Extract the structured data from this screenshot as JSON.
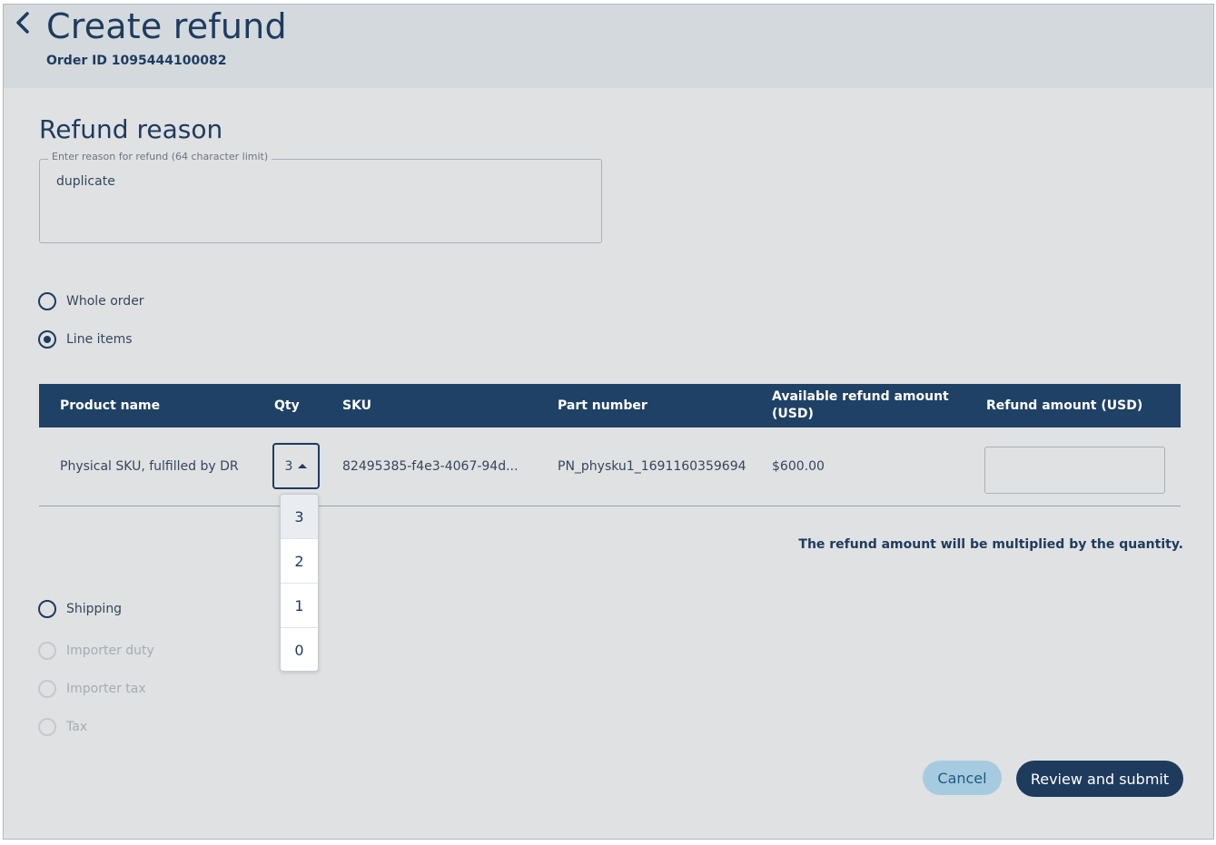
{
  "header": {
    "title": "Create refund",
    "order_id": "Order ID 1095444100082"
  },
  "reason": {
    "section_title": "Refund reason",
    "field_label": "Enter reason for refund (64 character limit)",
    "value": "duplicate"
  },
  "scope_options": {
    "whole_order": "Whole order",
    "line_items": "Line items",
    "selected": "Line items"
  },
  "table": {
    "columns": [
      "Product name",
      "Qty",
      "SKU",
      "Part number",
      "Available refund amount (USD)",
      "Refund amount (USD)"
    ],
    "rows": [
      {
        "product_name": "Physical SKU, fulfilled by DR",
        "qty": "3",
        "sku": "82495385-f4e3-4067-94d...",
        "part_number": "PN_physku1_1691160359694",
        "available_amount": "$600.00",
        "refund_amount": ""
      }
    ]
  },
  "qty_dropdown": {
    "options": [
      "3",
      "2",
      "1",
      "0"
    ],
    "selected": "3"
  },
  "note": "The refund amount will be multiplied by the quantity.",
  "extra_options": {
    "shipping": "Shipping",
    "importer_duty": "Importer duty",
    "importer_tax": "Importer tax",
    "tax": "Tax"
  },
  "actions": {
    "cancel": "Cancel",
    "submit": "Review and submit"
  },
  "colors": {
    "primary": "#1e3b5e",
    "header_bg": "#d3d9dd",
    "page_bg": "#dfe1e3",
    "cancel_bg": "#a6cbe0"
  }
}
